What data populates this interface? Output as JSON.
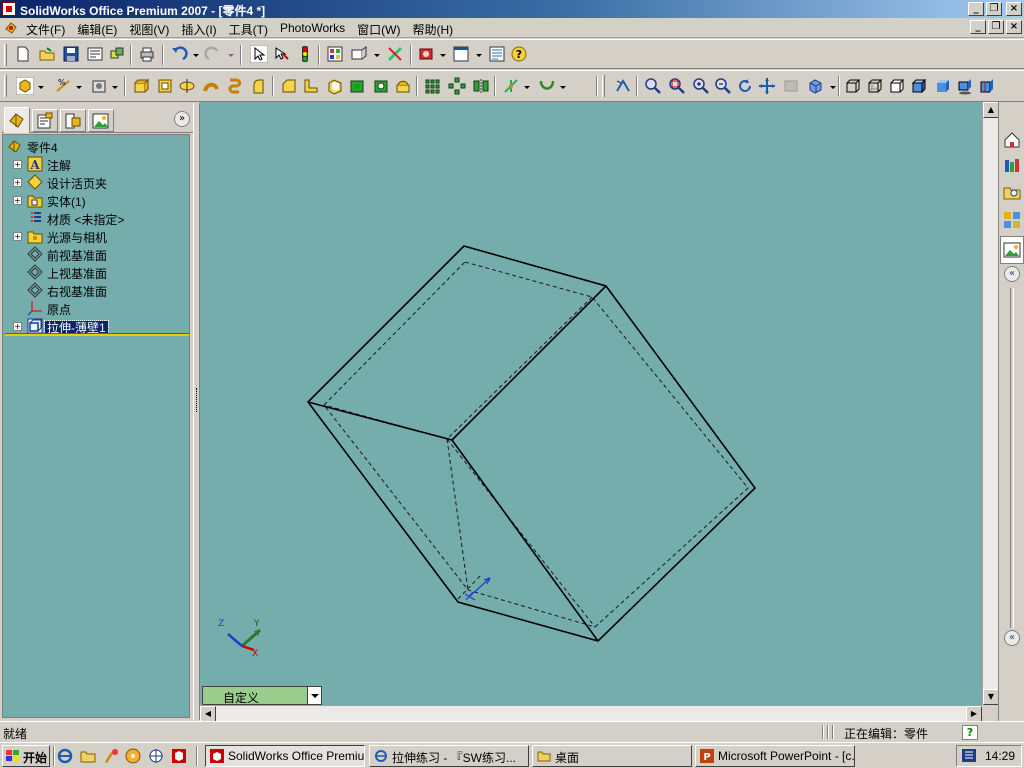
{
  "window": {
    "title": "SolidWorks Office Premium 2007 - [零件4 *]",
    "controls": {
      "minimize": "_",
      "restore": "❐",
      "close": "×"
    }
  },
  "menu": {
    "items": [
      "文件(F)",
      "编辑(E)",
      "视图(V)",
      "插入(I)",
      "工具(T)",
      "PhotoWorks",
      "窗口(W)",
      "帮助(H)"
    ]
  },
  "feature_tree": {
    "root": "零件4",
    "items": [
      {
        "label": "注解",
        "icon": "annotations-icon",
        "expandable": true
      },
      {
        "label": "设计活页夹",
        "icon": "design-binder-icon",
        "expandable": true
      },
      {
        "label": "实体(1)",
        "icon": "solid-bodies-icon",
        "expandable": true
      },
      {
        "label": "材质 <未指定>",
        "icon": "material-icon",
        "expandable": false
      },
      {
        "label": "光源与相机",
        "icon": "lights-cameras-icon",
        "expandable": true
      },
      {
        "label": "前视基准面",
        "icon": "plane-icon",
        "expandable": false
      },
      {
        "label": "上视基准面",
        "icon": "plane-icon",
        "expandable": false
      },
      {
        "label": "右视基准面",
        "icon": "plane-icon",
        "expandable": false
      },
      {
        "label": "原点",
        "icon": "origin-icon",
        "expandable": false
      },
      {
        "label": "拉伸-薄壁1",
        "icon": "extrude-thin-icon",
        "expandable": true,
        "selected": true
      }
    ]
  },
  "viewport": {
    "background": "#75adad",
    "view_orientation": "自定义",
    "triad": {
      "x": "X",
      "y": "Y",
      "z": "Z"
    }
  },
  "status": {
    "left": "就绪",
    "right": "正在编辑：零件",
    "help": "?"
  },
  "taskbar": {
    "start": "开始",
    "tasks": [
      {
        "label": "SolidWorks Office Premiu...",
        "active": true
      },
      {
        "label": "拉伸练习 - 『SW练习...",
        "active": false
      },
      {
        "label": "桌面",
        "active": false
      },
      {
        "label": "Microsoft PowerPoint - [c...",
        "active": false
      }
    ],
    "clock": "14:29"
  },
  "colors": {
    "viewport_bg": "#75adad",
    "tree_bg": "#75adad",
    "selection": "#0a246a",
    "title_gradient_start": "#0a246a",
    "rollback_bar": "#e8d000"
  }
}
